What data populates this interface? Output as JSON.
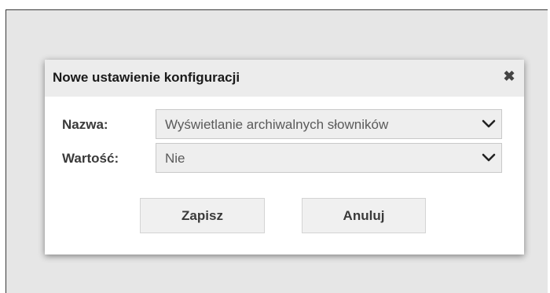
{
  "dialog": {
    "title": "Nowe ustawienie konfiguracji",
    "close_icon": "close-icon",
    "close_glyph": "✖"
  },
  "form": {
    "name_label": "Nazwa:",
    "name_value": "Wyświetlanie archiwalnych słowników",
    "value_label": "Wartość:",
    "value_value": "Nie",
    "dropdown_icon": "chevron-down-icon"
  },
  "buttons": {
    "save_label": "Zapisz",
    "cancel_label": "Anuluj"
  }
}
